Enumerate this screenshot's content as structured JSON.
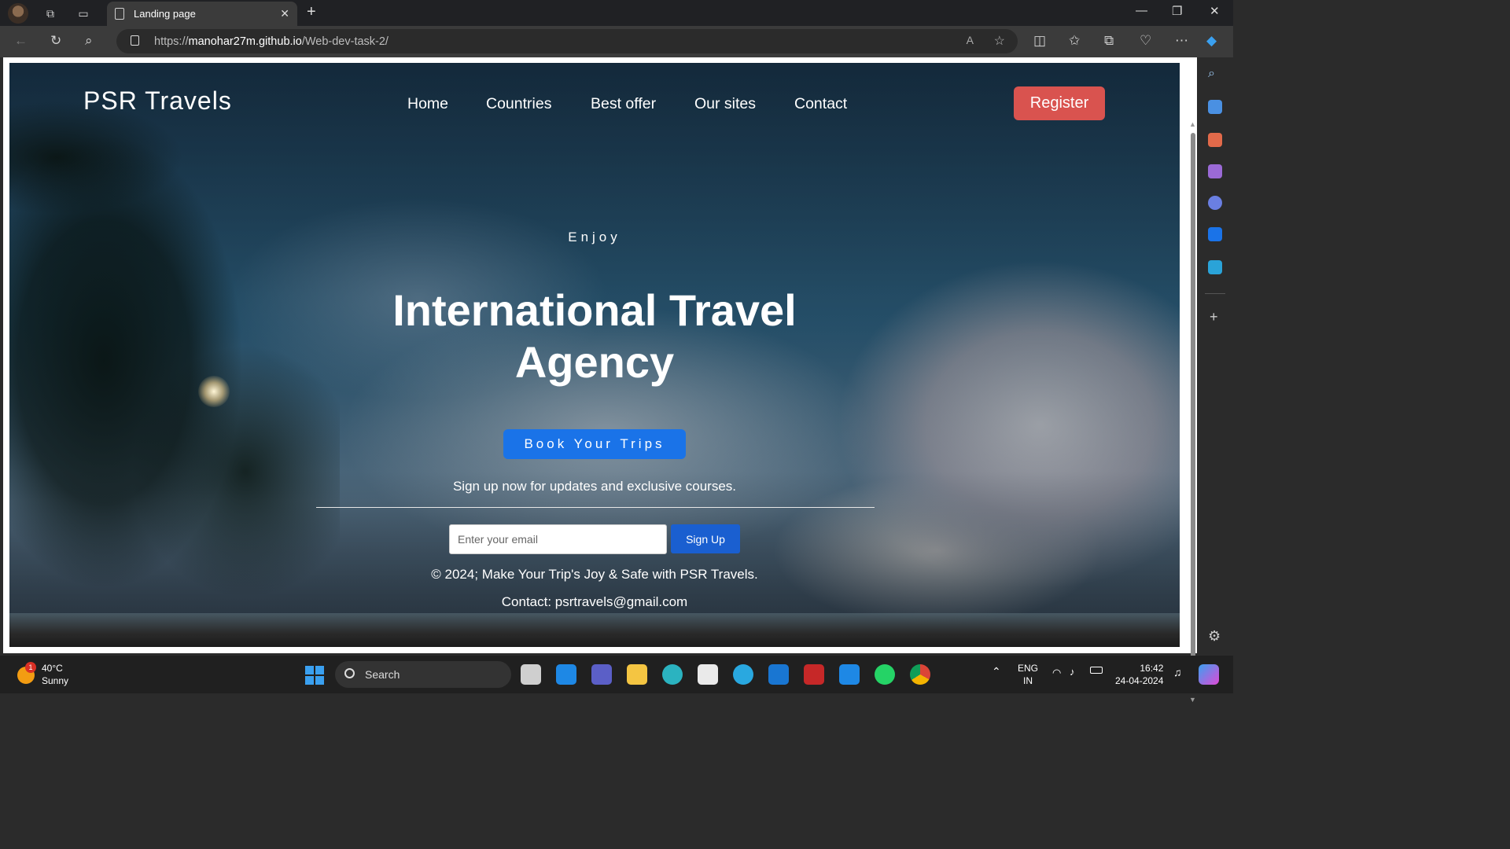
{
  "browser": {
    "tab_title": "Landing page",
    "url_prefix": "https://",
    "url_host": "manohar27m.github.io",
    "url_path": "/Web-dev-task-2/"
  },
  "site": {
    "brand": "PSR Travels",
    "nav": [
      "Home",
      "Countries",
      "Best offer",
      "Our sites",
      "Contact"
    ],
    "register_label": "Register",
    "kicker": "Enjoy",
    "headline_line1": "International Travel",
    "headline_line2": "Agency",
    "cta_label": "Book Your Trips",
    "signup_text": "Sign up now for updates and exclusive courses.",
    "email_placeholder": "Enter your email",
    "signup_button": "Sign Up",
    "copyright": "© 2024; Make Your Trip's Joy & Safe with PSR Travels.",
    "contact": "Contact: psrtravels@gmail.com",
    "colors": {
      "register": "#d9534f",
      "cta": "#1a73e8",
      "signup": "#1a5fd0"
    }
  },
  "taskbar": {
    "weather_badge": "1",
    "weather_temp": "40°C",
    "weather_desc": "Sunny",
    "search_label": "Search",
    "lang_line1": "ENG",
    "lang_line2": "IN",
    "time": "16:42",
    "date": "24-04-2024"
  }
}
